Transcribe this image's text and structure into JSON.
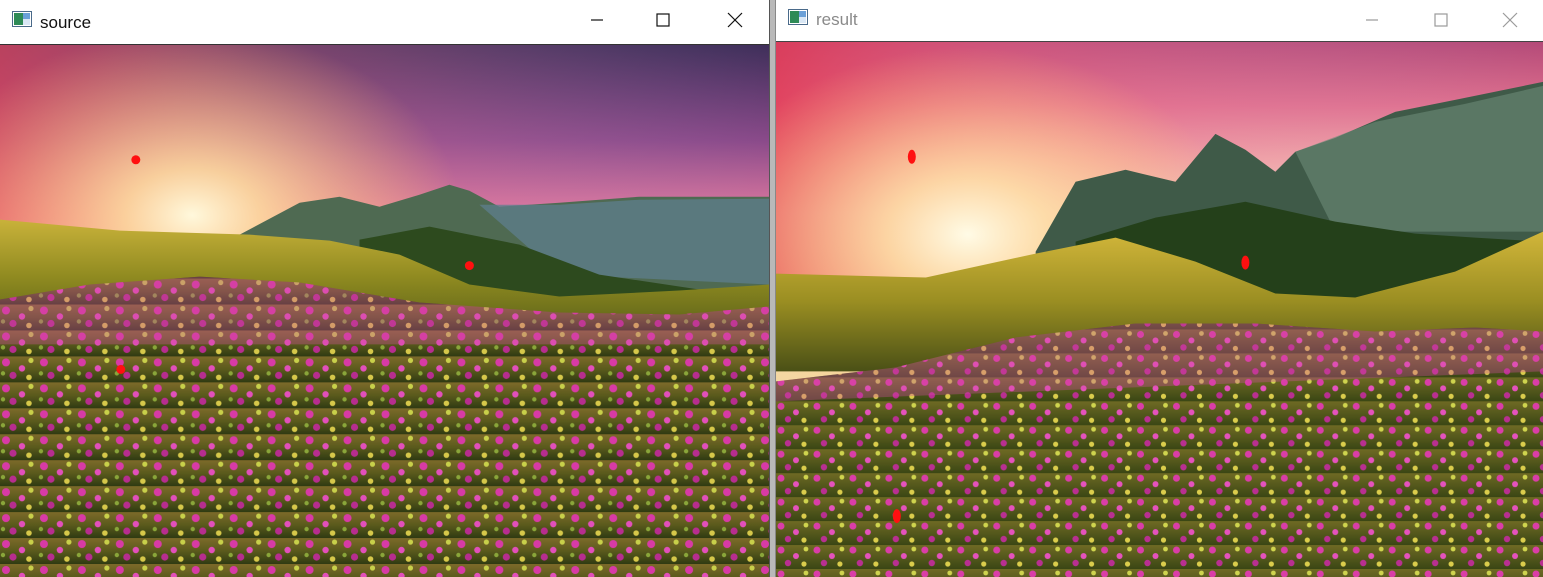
{
  "windows": {
    "source": {
      "title": "source",
      "active": true
    },
    "result": {
      "title": "result",
      "active": false
    }
  },
  "icons": {
    "app": "image-window-icon",
    "minimize": "minimize-icon",
    "maximize": "maximize-icon",
    "close": "close-icon"
  },
  "colors": {
    "marker": "#ff1010",
    "titlebar_bg": "#ffffff",
    "active_title": "#111111",
    "inactive_title": "#8a8a8a"
  }
}
